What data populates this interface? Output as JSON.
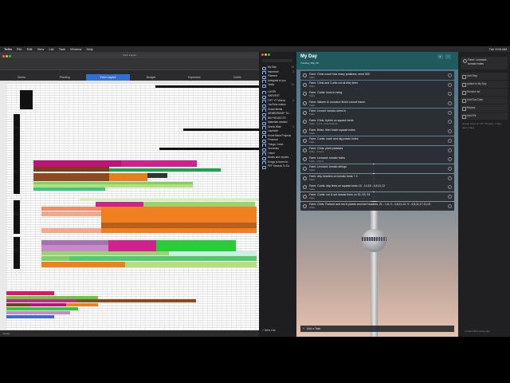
{
  "menubar": {
    "app": "ToDo",
    "items": [
      "File",
      "Edit",
      "View",
      "List",
      "Task",
      "Window",
      "Help"
    ],
    "clock": "Tue 9:04 AM"
  },
  "excel": {
    "title": "Farm Layout",
    "tabs": [
      "Seeds",
      "Planting",
      "Farm Layout",
      "Budget",
      "Expenses",
      "Debts"
    ],
    "active_tab": "Farm Layout",
    "beds": [
      "B4",
      "B3",
      "B2",
      "B1"
    ],
    "status": "Ready"
  },
  "sidebar": {
    "items": [
      {
        "label": "My Day",
        "count": "15"
      },
      {
        "label": "Important",
        "count": "3"
      },
      {
        "label": "Planned",
        "count": ""
      },
      {
        "label": "Assigned to you",
        "count": ""
      },
      {
        "label": "Tasks",
        "count": "12"
      },
      {
        "sep": true
      },
      {
        "label": "LAYER",
        "count": ""
      },
      {
        "label": "HARVEST",
        "count": ""
      },
      {
        "label": "FIFT YT Videos",
        "count": "6"
      },
      {
        "label": "YouTube videos",
        "count": ""
      },
      {
        "label": "Social Media",
        "count": ""
      },
      {
        "label": "MEMBERSHIP TU...",
        "count": ""
      },
      {
        "label": "BM PROJECTS",
        "count": ""
      },
      {
        "label": "Materials needed",
        "count": ""
      },
      {
        "label": "Seeds Wish",
        "count": "6"
      },
      {
        "label": "Lavender",
        "count": ""
      },
      {
        "label": "Home Base Projects",
        "count": ""
      },
      {
        "label": "Personal",
        "count": ""
      },
      {
        "label": "Things I need",
        "count": ""
      },
      {
        "label": "Groceries",
        "count": ""
      },
      {
        "label": "Travel",
        "count": ""
      },
      {
        "label": "Books and movies...",
        "count": ""
      },
      {
        "label": "Songs to learn for...",
        "count": ""
      },
      {
        "label": "PFF Generic To Do",
        "count": ""
      }
    ],
    "new_list": "New List"
  },
  "todo": {
    "title": "My Day",
    "date": "Tuesday, May 28",
    "tasks": [
      {
        "title": "Farm: Chris count how many potatoes; need 300",
        "sub": "Tasks"
      },
      {
        "title": "Farm: Chris and Curtis cut all dirty lines",
        "sub": "Tasks"
      },
      {
        "title": "Farm: Curtis: tools to bring",
        "sub": "Tasks"
      },
      {
        "title": "Farm: Warren & Leonard: finish Leonel frame",
        "sub": "Tasks"
      },
      {
        "title": "Farm: Leonel: tomato wires in",
        "sub": "Tasks"
      },
      {
        "title": "Farm: Chris: hybrid on squash beds",
        "sub": "Tasks · 1 of 3 · Chris Kickman"
      },
      {
        "title": "Farm: Brian: fiber finish squash holes",
        "sub": "Tasks"
      },
      {
        "title": "Farm: Curtis: mark and dig potato holes",
        "sub": "Tasks"
      },
      {
        "title": "Farm: Chris: plant potatoes",
        "sub": "Tasks · 4 items"
      },
      {
        "title": "Farm: Leonard: tomato holes",
        "sub": "Tasks · 1 items"
      },
      {
        "title": "Farm: Leonard: tomato strings",
        "sub": "Tasks"
      },
      {
        "title": "Farm: drip headers on tomato beds + 4",
        "sub": "Tasks"
      },
      {
        "title": "Farm: Curtis: drip lines on squash beds 10 - 14,18 - 4,8,11,12",
        "sub": "Tasks"
      },
      {
        "title": "Farm: Curtis: cut & set header lines on 90, 93, 93",
        "sub": "Tasks"
      },
      {
        "title": "Farm: Chris: Purlune and set in plants and bed headers, 21 - 1.8, 9 - 4,8,11,12, 9 - 4,8,11,17,11,13",
        "sub": "Tasks"
      }
    ],
    "add_task": "Add a Task"
  },
  "detail": {
    "task_title": "Farm: Leonard:",
    "task_sub": "tomato holes",
    "actions": [
      "Add Step",
      "Added to My Day",
      "Remind me",
      "Add Due Date",
      "Repeat",
      "Add File"
    ],
    "note": "20 day cross at *18* 7/8 days, 7 days plan 4 days",
    "footer": "Created 38 minutes ago"
  },
  "colors": {
    "accent": "#2f6fd6",
    "header_teal": "#1f5a5e"
  }
}
